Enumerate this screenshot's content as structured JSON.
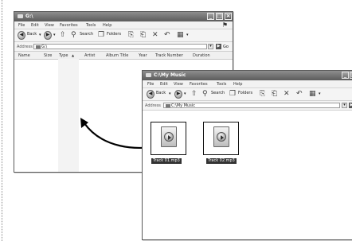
{
  "left_window": {
    "title": "G:\\",
    "menu": [
      "File",
      "Edit",
      "View",
      "Favorites",
      "Tools",
      "Help"
    ],
    "toolbar": {
      "back": "Back",
      "search": "Search",
      "folders": "Folders"
    },
    "address": {
      "label": "Address",
      "value": "G:\\",
      "go": "Go"
    },
    "columns": [
      "Name",
      "Size",
      "Type",
      "Artist",
      "Album Title",
      "Year",
      "Track Number",
      "Duration"
    ]
  },
  "right_window": {
    "title": "C:\\My Music",
    "menu": [
      "File",
      "Edit",
      "View",
      "Favorites",
      "Tools",
      "Help"
    ],
    "toolbar": {
      "back": "Back",
      "search": "Search",
      "folders": "Folders"
    },
    "address": {
      "label": "Address",
      "value": "C:\\My Music"
    },
    "files": [
      {
        "name": "Track 01.mp3",
        "icon": "mp3-file-icon"
      },
      {
        "name": "Track 02.mp3",
        "icon": "mp3-file-icon"
      }
    ]
  },
  "drag_arrow": {
    "icon": "drag-arrow",
    "color": "#000000"
  }
}
